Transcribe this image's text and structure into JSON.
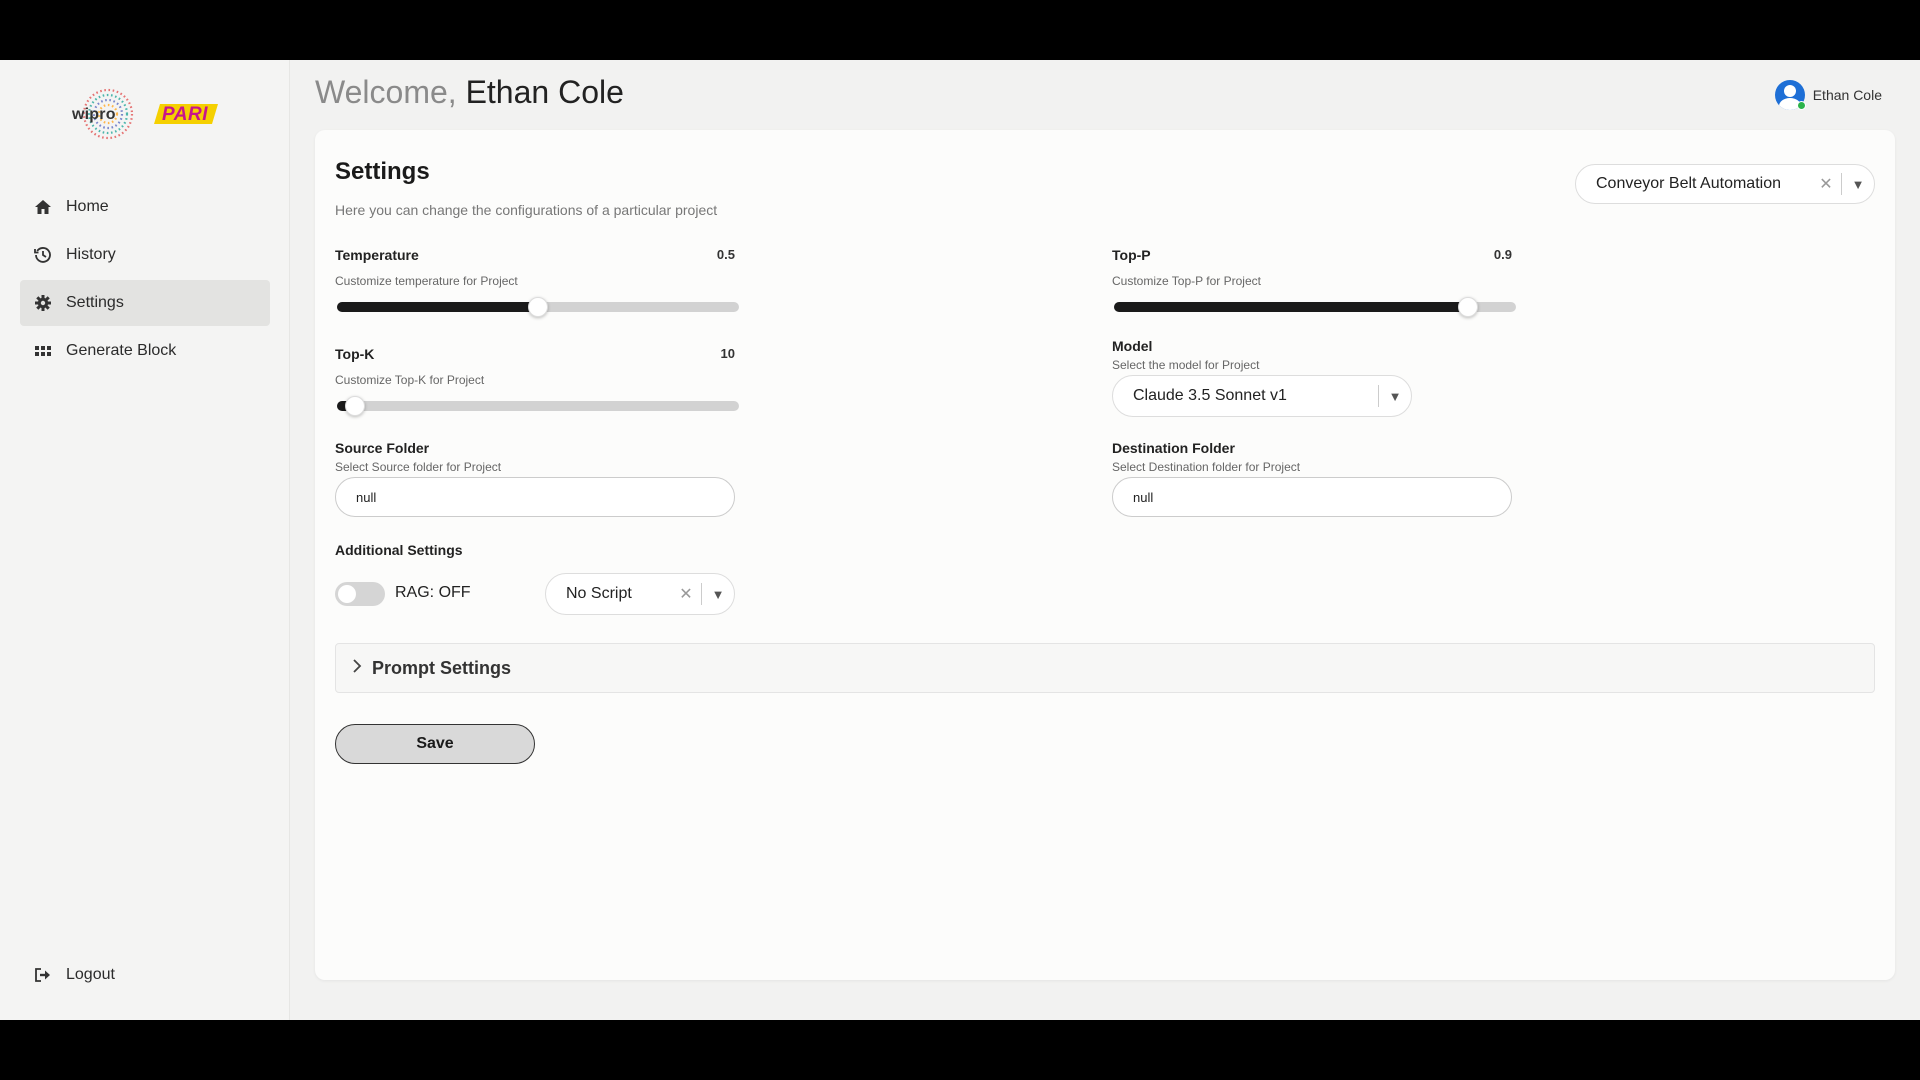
{
  "brand": {
    "logo_text": "wipro",
    "partner_logo_text": "PARI"
  },
  "sidebar": {
    "items": [
      {
        "label": "Home",
        "icon": "home-icon"
      },
      {
        "label": "History",
        "icon": "history-icon"
      },
      {
        "label": "Settings",
        "icon": "gear-icon",
        "active": true
      },
      {
        "label": "Generate Block",
        "icon": "grid-icon"
      }
    ],
    "logout_label": "Logout"
  },
  "header": {
    "welcome_prefix": "Welcome, ",
    "user_name": "Ethan Cole"
  },
  "user_menu": {
    "name": "Ethan Cole",
    "status_color": "#2cb34a"
  },
  "settings": {
    "title": "Settings",
    "subtitle": "Here you can change the configurations of a particular project",
    "project": {
      "selected": "Conveyor Belt Automation"
    },
    "temperature": {
      "label": "Temperature",
      "value_text": "0.5",
      "value": 0.5,
      "min": 0,
      "max": 1,
      "description": "Customize temperature for Project"
    },
    "top_p": {
      "label": "Top-P",
      "value_text": "0.9",
      "value": 0.9,
      "min": 0,
      "max": 1,
      "description": "Customize Top-P for Project"
    },
    "top_k": {
      "label": "Top-K",
      "value_text": "10",
      "value": 10,
      "min": 0,
      "max": 500,
      "description": "Customize Top-K for Project"
    },
    "model": {
      "label": "Model",
      "description": "Select the model for Project",
      "selected": "Claude 3.5 Sonnet v1"
    },
    "source_folder": {
      "label": "Source Folder",
      "description": "Select Source folder for Project",
      "value": "null"
    },
    "destination_folder": {
      "label": "Destination Folder",
      "description": "Select Destination folder for Project",
      "value": "null"
    },
    "additional": {
      "label": "Additional Settings",
      "rag_label": "RAG: OFF",
      "rag_on": false,
      "script": {
        "selected": "No Script"
      }
    },
    "prompt_settings_label": "Prompt Settings",
    "save_label": "Save"
  },
  "colors": {
    "slider_fill": "#1a1a1a",
    "slider_track": "#d2d2d2",
    "accent_blue": "#1e6fd6",
    "pari_brand": "#c8148c"
  }
}
